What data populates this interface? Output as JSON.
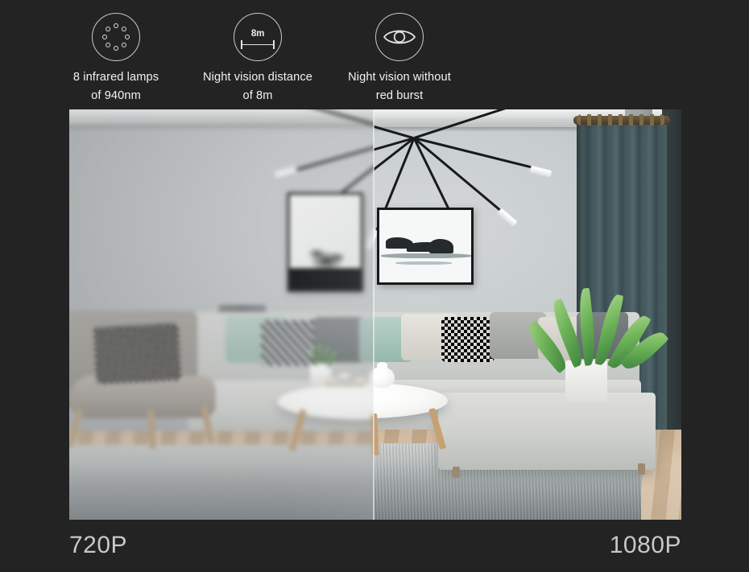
{
  "background_color": "#232323",
  "features": [
    {
      "icon": "infrared-lamp-ring-icon",
      "line1": "8 infrared lamps",
      "line2": "of 940nm"
    },
    {
      "icon": "distance-measure-icon",
      "icon_text": "8m",
      "line1": "Night vision distance",
      "line2": "of 8m"
    },
    {
      "icon": "eye-icon",
      "line1": "Night vision without",
      "line2": "red burst"
    }
  ],
  "comparison": {
    "left_label": "720P",
    "right_label": "1080P",
    "scene_description": "Living room interior with sectional sofa, coffee table, chandelier, framed artwork, plant and curtain",
    "left_quality": "blurred low resolution",
    "right_quality": "sharp high resolution"
  },
  "text_color": "#f2f2f2",
  "label_color": "#c7c8c8",
  "accent_color": "#c9c9c9"
}
